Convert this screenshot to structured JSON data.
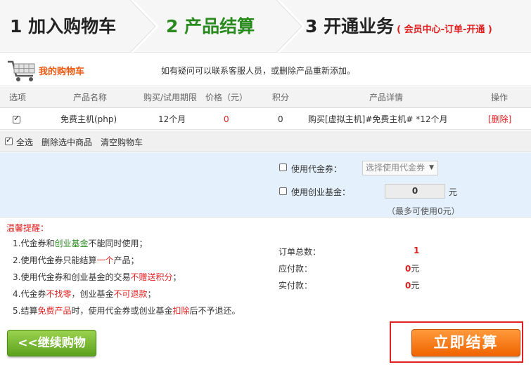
{
  "steps": {
    "step1": "1 加入购物车",
    "step2": "2 产品结算",
    "step3": "3 开通业务",
    "step3_note": "( 会员中心-订单-开通 )"
  },
  "cart": {
    "title": "我的购物车",
    "hint": "如有疑问可以联系客服人员，或删除产品重新添加。"
  },
  "table": {
    "headers": [
      "选项",
      "产品名称",
      "购买/试用期限",
      "价格（元）",
      "积分",
      "产品详情",
      "操作"
    ],
    "rows": [
      {
        "checked": true,
        "name": "免费主机(php)",
        "period": "12个月",
        "price": "0",
        "points": "0",
        "detail": "购买[虚拟主机]#免费主机# *12个月",
        "action": "[删除]"
      }
    ]
  },
  "bulk": {
    "select_all": "全选",
    "delete_selected": "删除选中商品",
    "clear_cart": "清空购物车"
  },
  "voucher": {
    "use_voucher_label": "使用代金券：",
    "voucher_select_value": "选择使用代金券",
    "use_fund_label": "使用创业基金：",
    "fund_value": "0",
    "fund_unit": "元",
    "fund_max_note": "（最多可使用0元）"
  },
  "tips": {
    "title": "温馨提醒：",
    "t1a": "1.代金券和",
    "t1b": "创业基金",
    "t1c": "不能同时使用；",
    "t2a": "2.使用代金券只能结算",
    "t2b": "一个",
    "t2c": "产品；",
    "t3a": "3.使用代金券和创业基金的交易",
    "t3b": "不赠送积分",
    "t3c": "；",
    "t4a": "4.代金券",
    "t4b": "不找零",
    "t4c": "，创业基金",
    "t4d": "不可退款",
    "t4e": "；",
    "t5a": "5.结算",
    "t5b": "免费产品",
    "t5c": "时，使用代金券或创业基金",
    "t5d": "扣除",
    "t5e": "后不予退还。"
  },
  "summary": {
    "order_total_label": "订单总数：",
    "order_total_value": "1",
    "payable_label": "应付款：",
    "payable_value": "0",
    "paid_label": "实付款：",
    "paid_value": "0",
    "currency": "元"
  },
  "buttons": {
    "continue_label": "<<继续购物",
    "checkout_label": "立即结算"
  },
  "colors": {
    "active_step": "#2a8a1f",
    "accent_red": "#e02020",
    "cart_title": "#e85a12",
    "continue_green": "#5ba11d",
    "checkout_orange": "#f06400",
    "voucher_bg": "#e4f0fb"
  }
}
